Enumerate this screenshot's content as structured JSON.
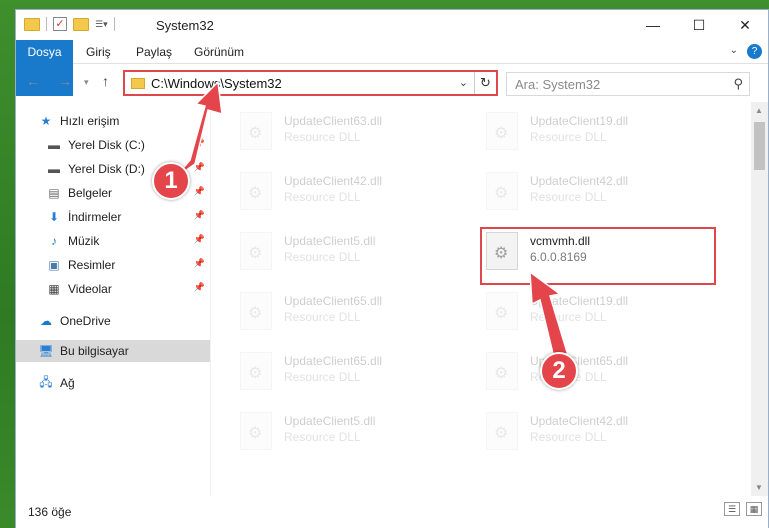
{
  "window": {
    "title": "System32"
  },
  "ribbon": {
    "tabs": [
      "Dosya",
      "Giriş",
      "Paylaş",
      "Görünüm"
    ]
  },
  "address": {
    "path": "C:\\Windows\\System32"
  },
  "search": {
    "placeholder": "Ara: System32"
  },
  "sidebar": {
    "items": [
      {
        "label": "Hızlı erişim",
        "icon": "star-icon"
      },
      {
        "label": "Yerel Disk (C:)",
        "icon": "drive-icon",
        "pinned": true
      },
      {
        "label": "Yerel Disk (D:)",
        "icon": "drive-icon",
        "pinned": true
      },
      {
        "label": "Belgeler",
        "icon": "documents-icon",
        "pinned": true
      },
      {
        "label": "İndirmeler",
        "icon": "download-icon",
        "pinned": true
      },
      {
        "label": "Müzik",
        "icon": "music-icon",
        "pinned": true
      },
      {
        "label": "Resimler",
        "icon": "pictures-icon",
        "pinned": true
      },
      {
        "label": "Videolar",
        "icon": "videos-icon",
        "pinned": true
      },
      {
        "label": "OneDrive",
        "icon": "cloud-icon"
      },
      {
        "label": "Bu bilgisayar",
        "icon": "computer-icon",
        "selected": true
      },
      {
        "label": "Ağ",
        "icon": "network-icon"
      }
    ]
  },
  "files": [
    {
      "name": "UpdateClient63.dll",
      "sub": "Resource DLL"
    },
    {
      "name": "UpdateClient19.dll",
      "sub": "Resource DLL"
    },
    {
      "name": "UpdateClient42.dll",
      "sub": "Resource DLL"
    },
    {
      "name": "UpdateClient42.dll",
      "sub": "Resource DLL"
    },
    {
      "name": "UpdateClient5.dll",
      "sub": "Resource DLL"
    },
    {
      "name": "vcmvmh.dll",
      "sub": "6.0.0.8169",
      "highlighted": true
    },
    {
      "name": "UpdateClient65.dll",
      "sub": "Resource DLL"
    },
    {
      "name": "UpdateClient19.dll",
      "sub": "Resource DLL"
    },
    {
      "name": "UpdateClient65.dll",
      "sub": "Resource DLL"
    },
    {
      "name": "UpdateClient65.dll",
      "sub": "Resource DLL"
    },
    {
      "name": "UpdateClient5.dll",
      "sub": "Resource DLL"
    },
    {
      "name": "UpdateClient42.dll",
      "sub": "Resource DLL"
    }
  ],
  "status": {
    "count": "136 öğe"
  },
  "annotations": {
    "step1": "1",
    "step2": "2"
  },
  "colors": {
    "accent": "#1979ca",
    "highlight": "#e0474c"
  }
}
